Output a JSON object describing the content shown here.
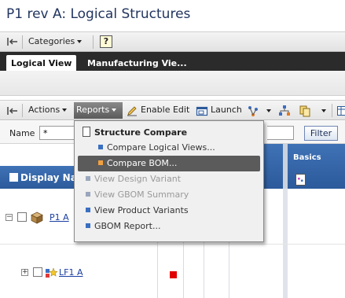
{
  "window": {
    "title": "P1 rev A: Logical Structures"
  },
  "category_bar": {
    "categories_label": "Categories",
    "help_label": "?"
  },
  "tabs": [
    {
      "label": "Logical View",
      "active": true
    },
    {
      "label": "Manufacturing Vie...",
      "active": false
    }
  ],
  "toolbar": {
    "actions_label": "Actions",
    "reports_label": "Reports",
    "enable_edit_label": "Enable Edit",
    "launch_label": "Launch"
  },
  "filter": {
    "name_label": "Name",
    "name_value": "*",
    "filter_button": "Filter"
  },
  "grid": {
    "columns": {
      "display_name": "Display Na",
      "basics": "Basics"
    },
    "rows": [
      {
        "label": "P1 A",
        "expander": "−",
        "icon": "part-cube-icon"
      },
      {
        "label": "LF1 A",
        "expander": "+",
        "icon": "logical-feature-icon"
      }
    ]
  },
  "reports_menu": {
    "header": "Structure Compare",
    "items": [
      {
        "label": "Compare Logical Views...",
        "indent": true,
        "state": "normal",
        "bullet": "#3a6fc2"
      },
      {
        "label": "Compare BOM...",
        "indent": true,
        "state": "highlighted",
        "bullet": "#f0a040"
      },
      {
        "label": "View Design Variant",
        "indent": false,
        "state": "disabled",
        "bullet": "#9aa6bd"
      },
      {
        "label": "View GBOM Summary",
        "indent": false,
        "state": "disabled",
        "bullet": "#9aa6bd"
      },
      {
        "label": "View Product Variants",
        "indent": false,
        "state": "normal",
        "bullet": "#3a6fc2"
      },
      {
        "label": "GBOM Report...",
        "indent": false,
        "state": "normal",
        "bullet": "#3a6fc2"
      }
    ]
  },
  "colors": {
    "title": "#22355f",
    "header_blue": "#3a6bb0",
    "highlight": "#5b5b5b",
    "marker_red": "#e00000"
  }
}
